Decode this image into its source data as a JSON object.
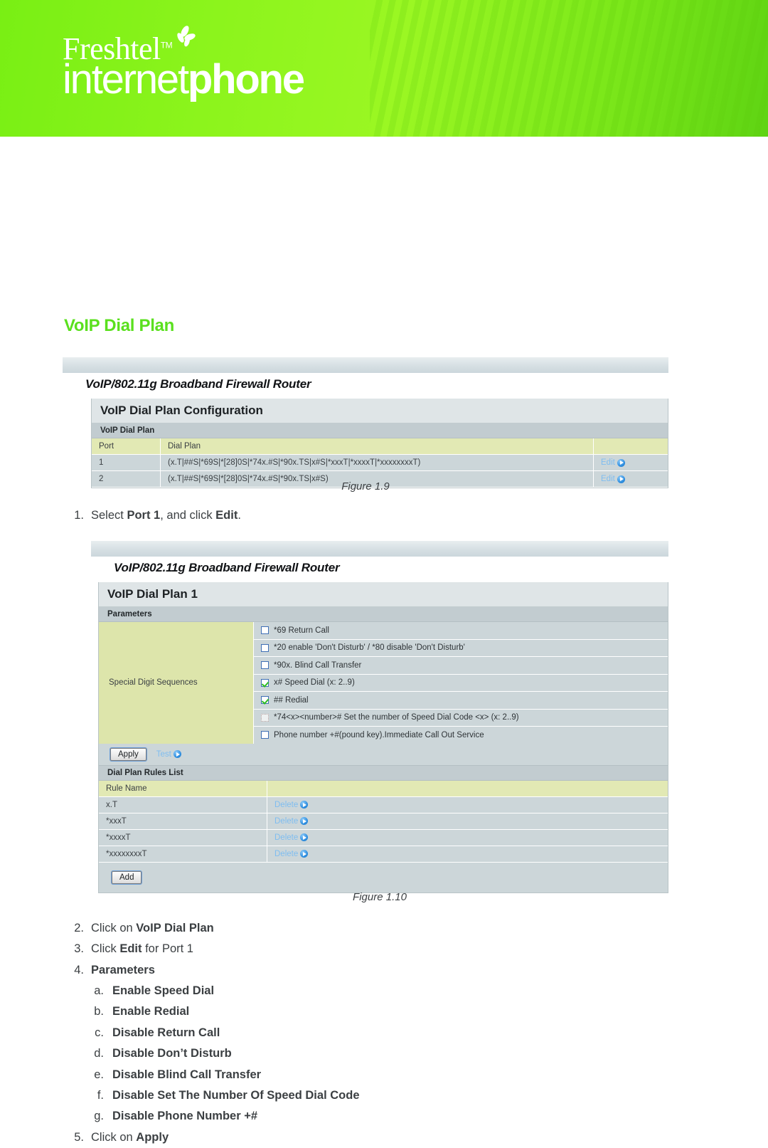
{
  "banner": {
    "brand_top": "Freshtel",
    "brand_tm": "TM",
    "brand_bottom_thin": "internet",
    "brand_bottom_bold": "phone",
    "accent_green": "#8cf41c"
  },
  "page": {
    "section_title": "VoIP Dial Plan",
    "section_title_color": "#5ae01e"
  },
  "figure_1_9": {
    "router_title": "VoIP/802.11g Broadband Firewall Router",
    "panel_head": "VoIP Dial Plan Configuration",
    "panel_sub": "VoIP Dial Plan",
    "columns": [
      "Port",
      "Dial Plan",
      ""
    ],
    "rows": [
      {
        "port": "1",
        "dial_plan": "(x.T|##S|*69S|*[28]0S|*74x.#S|*90x.TS|x#S|*xxxT|*xxxxT|*xxxxxxxxT)",
        "action": "Edit"
      },
      {
        "port": "2",
        "dial_plan": "(x.T|##S|*69S|*[28]0S|*74x.#S|*90x.TS|x#S)",
        "action": "Edit"
      }
    ],
    "caption": "Figure 1.9"
  },
  "figure_1_10": {
    "router_title": "VoIP/802.11g Broadband Firewall Router",
    "panel_head": "VoIP Dial Plan 1",
    "panel_sub": "Parameters",
    "param_label": "Special Digit Sequences",
    "checkboxes": [
      {
        "label": "*69 Return Call",
        "checked": false,
        "disabled": false
      },
      {
        "label": "*20 enable 'Don't Disturb' / *80 disable 'Don't Disturb'",
        "checked": false,
        "disabled": false
      },
      {
        "label": "*90x. Blind Call Transfer",
        "checked": false,
        "disabled": false
      },
      {
        "label": "x# Speed Dial (x: 2..9)",
        "checked": true,
        "disabled": false
      },
      {
        "label": "## Redial",
        "checked": true,
        "disabled": false
      },
      {
        "label": "*74<x><number># Set the number of Speed Dial Code <x> (x: 2..9)",
        "checked": false,
        "disabled": true
      },
      {
        "label": "Phone number +#(pound key).Immediate Call Out Service",
        "checked": false,
        "disabled": false
      }
    ],
    "apply_label": "Apply",
    "test_label": "Test",
    "rules_head": "Dial Plan Rules List",
    "rules_column": "Rule Name",
    "rules": [
      {
        "name": "x.T",
        "action": "Delete"
      },
      {
        "name": "*xxxT",
        "action": "Delete"
      },
      {
        "name": "*xxxxT",
        "action": "Delete"
      },
      {
        "name": "*xxxxxxxxT",
        "action": "Delete"
      }
    ],
    "add_label": "Add",
    "caption": "Figure 1.10"
  },
  "steps": [
    {
      "num": "1.",
      "html": "Select <b>Port 1</b>, and click <b>Edit</b>.",
      "level": "top"
    },
    {
      "num": "2.",
      "html": "Click on <b>VoIP Dial Plan</b>",
      "level": "top"
    },
    {
      "num": "3.",
      "html": "Click <b>Edit</b> for Port 1",
      "level": "top"
    },
    {
      "num": "4.",
      "html": "<b>Parameters</b>",
      "level": "top"
    },
    {
      "num": "a.",
      "html": "Enable Speed Dial",
      "level": "sub"
    },
    {
      "num": "b.",
      "html": "Enable Redial",
      "level": "sub"
    },
    {
      "num": "c.",
      "html": "Disable Return Call",
      "level": "sub"
    },
    {
      "num": "d.",
      "html": "Disable Don’t Disturb",
      "level": "sub"
    },
    {
      "num": "e.",
      "html": "Disable Blind Call Transfer",
      "level": "sub"
    },
    {
      "num": "f.",
      "html": "Disable Set The Number Of Speed Dial Code",
      "level": "sub"
    },
    {
      "num": "g.",
      "html": "Disable Phone Number +#",
      "level": "sub"
    },
    {
      "num": "5.",
      "html": "Click on <b>Apply</b>",
      "level": "top"
    }
  ]
}
